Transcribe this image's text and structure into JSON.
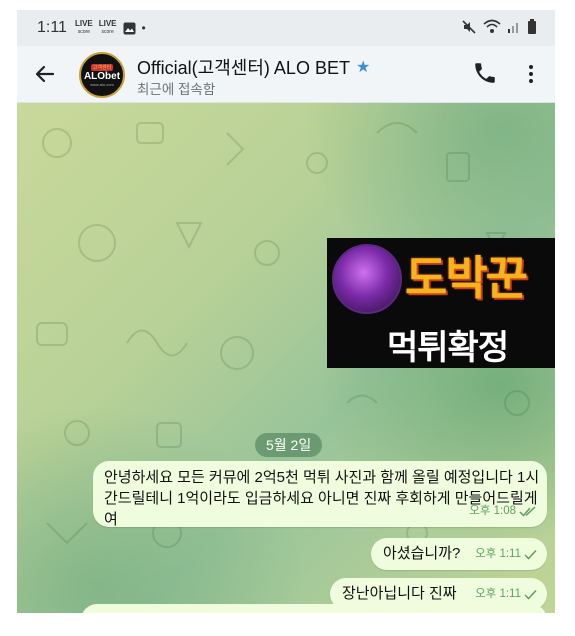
{
  "status_bar": {
    "time": "1:11",
    "live_1": "LIVE",
    "live_1_sub": "score",
    "live_2": "LIVE",
    "live_2_sub": "score",
    "dot": "•"
  },
  "header": {
    "title": "Official(고객센터) ALO BET",
    "subtitle": "최근에 접속함",
    "avatar_top": "고객센터",
    "avatar_main": "ALObet",
    "avatar_bottom": "www.alo.com"
  },
  "overlay": {
    "big_text": "도박꾼",
    "small_text": "먹튀확정"
  },
  "chat": {
    "date_chip": "5월 2일",
    "messages": [
      {
        "text": "안녕하세요 모든 커뮤에 2억5천 먹튀 사진과 함께 올릴 예정입니다 1시간드릴테니 1억이라도 입금하세요 아니면 진짜 후회하게 만들어드릴게여",
        "time": "오후 1:08",
        "status": "read"
      },
      {
        "text": "아셨습니까?",
        "time": "오후 1:11",
        "status": "sent"
      },
      {
        "text": "장난아닙니다 진짜",
        "time": "오후 1:11",
        "status": "sent"
      }
    ]
  },
  "colors": {
    "bubble": "#effdde",
    "accent": "#3a8fe0",
    "meta": "#5fa05f"
  },
  "icons": [
    "back-arrow-icon",
    "call-icon",
    "more-vert-icon",
    "verified-star-icon",
    "mute-icon",
    "wifi-icon",
    "signal-icon",
    "battery-icon",
    "image-icon"
  ]
}
